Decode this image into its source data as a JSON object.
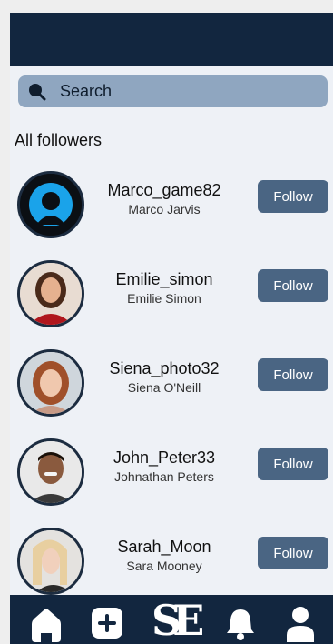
{
  "search": {
    "placeholder": "Search"
  },
  "section_title": "All followers",
  "followers": [
    {
      "username": "Marco_game82",
      "fullname": "Marco Jarvis",
      "button": "Follow"
    },
    {
      "username": "Emilie_simon",
      "fullname": "Emilie Simon",
      "button": "Follow"
    },
    {
      "username": "Siena_photo32",
      "fullname": "Siena O'Neill",
      "button": "Follow"
    },
    {
      "username": "John_Peter33",
      "fullname": "Johnathan Peters",
      "button": "Follow"
    },
    {
      "username": "Sarah_Moon",
      "fullname": "Sara Mooney",
      "button": "Follow"
    }
  ],
  "nav": {
    "logo": "SE",
    "icons": [
      "home-icon",
      "add-icon",
      "logo",
      "bell-icon",
      "profile-icon"
    ]
  },
  "colors": {
    "header": "#12263f",
    "search_bg": "#8fa6c0",
    "follow_button": "#4a6583",
    "page_bg": "#eef1f6"
  }
}
